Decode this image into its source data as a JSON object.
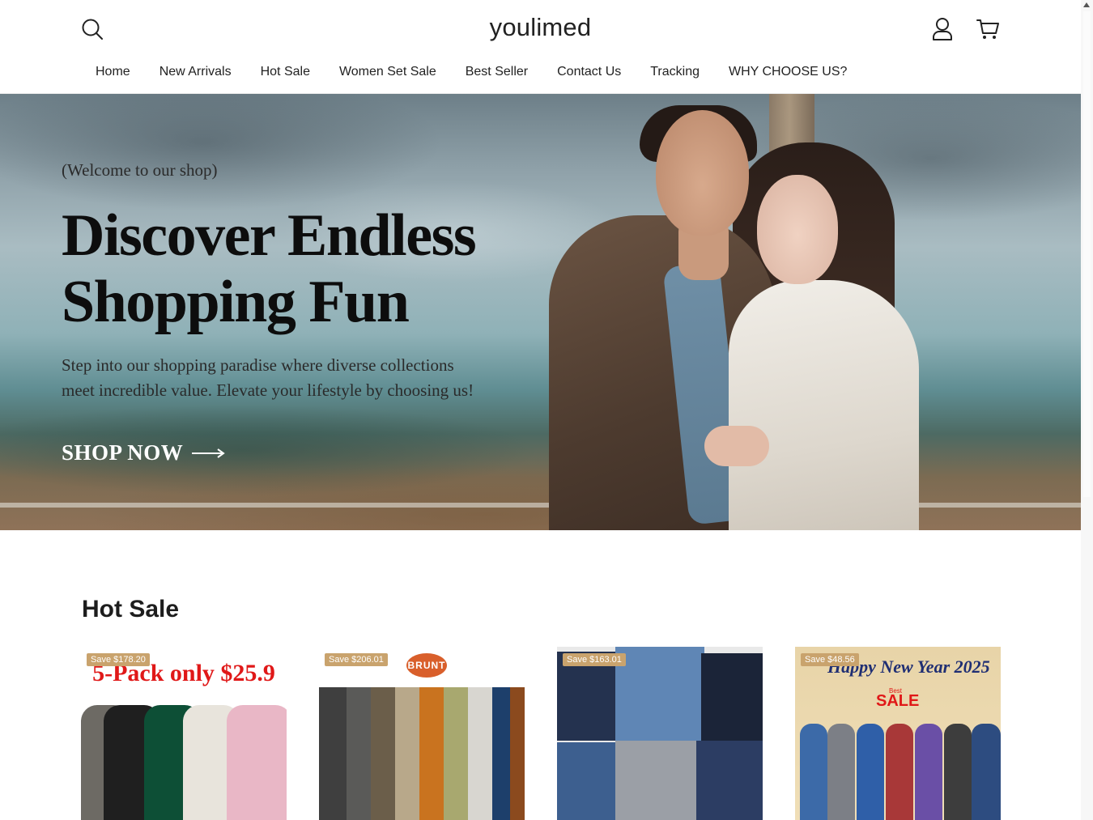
{
  "header": {
    "logo": "youlimed",
    "icons": {
      "search": "search-icon",
      "account": "account-icon",
      "cart": "cart-icon"
    }
  },
  "nav": {
    "items": [
      {
        "label": "Home"
      },
      {
        "label": "New Arrivals"
      },
      {
        "label": "Hot Sale"
      },
      {
        "label": "Women Set Sale"
      },
      {
        "label": "Best Seller"
      },
      {
        "label": "Contact Us"
      },
      {
        "label": "Tracking"
      },
      {
        "label": "WHY CHOOSE US?"
      }
    ]
  },
  "hero": {
    "subtitle": "(Welcome to our shop)",
    "title_line1": "Discover Endless",
    "title_line2": "Shopping Fun",
    "description_line1": "Step into our shopping paradise where diverse collections",
    "description_line2": "meet incredible value. Elevate your lifestyle by choosing us!",
    "cta_label": "SHOP NOW"
  },
  "hot_sale": {
    "title": "Hot Sale",
    "products": [
      {
        "badge": "Save $178.20",
        "image_text": "5-Pack only $25.9"
      },
      {
        "badge": "Save $206.01",
        "image_text": "BRUNT"
      },
      {
        "badge": "Save $163.01"
      },
      {
        "badge": "Save $48.56",
        "image_text": "Happy New Year 2025",
        "image_text_2": "SALE",
        "image_text_3": "Best"
      }
    ]
  },
  "colors": {
    "badge": "#c9a36d",
    "promo_red": "#e01818"
  }
}
